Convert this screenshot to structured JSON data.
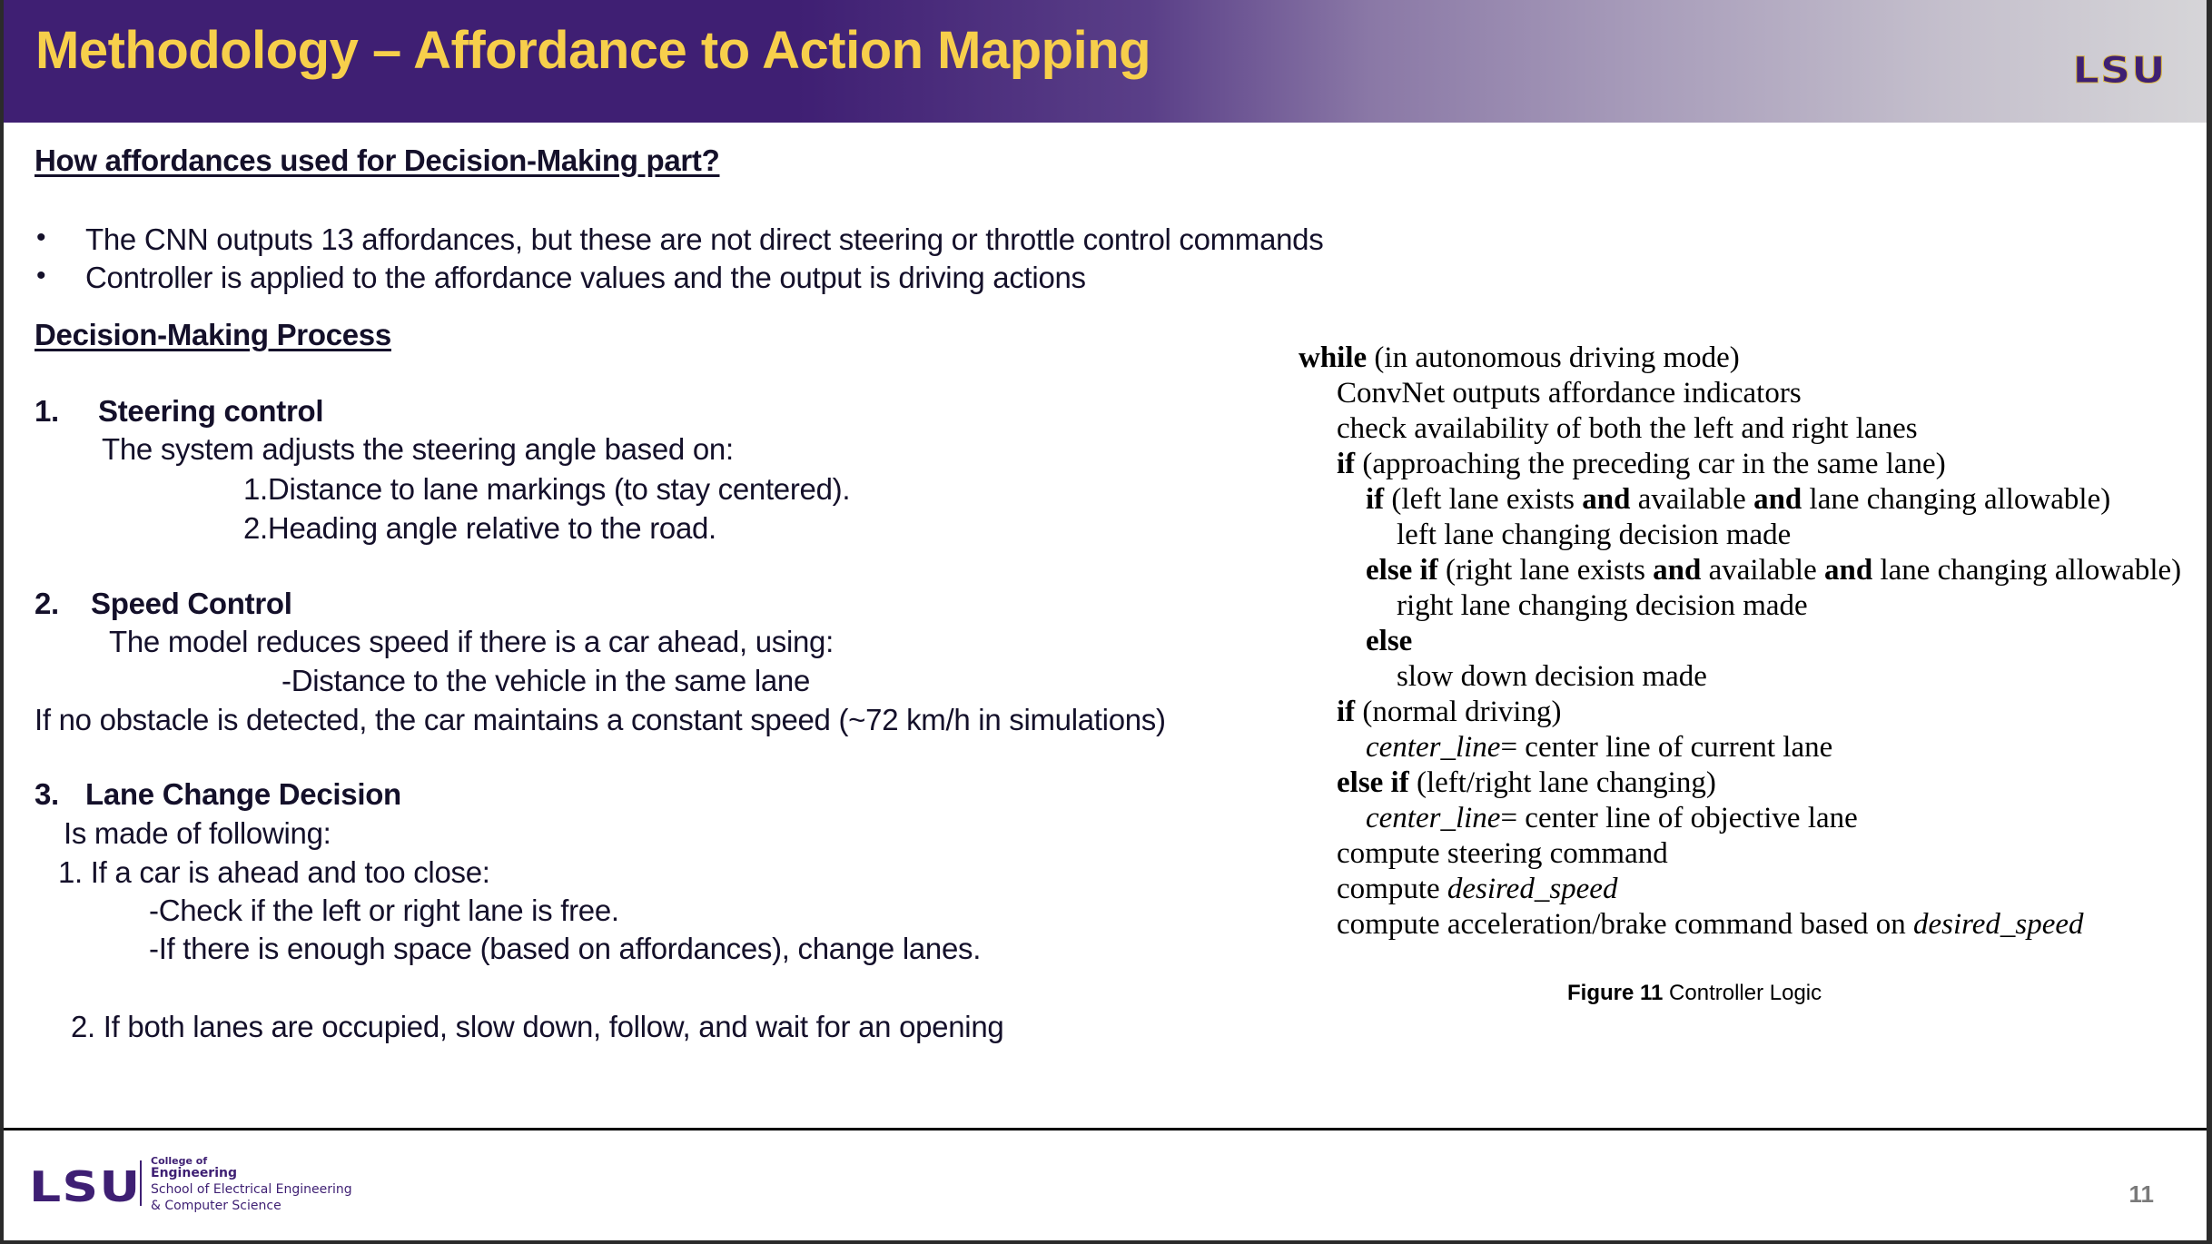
{
  "header": {
    "title": "Methodology – Affordance to Action Mapping",
    "logo_text": "LSU"
  },
  "intro": {
    "heading": "How affordances used for Decision-Making part?",
    "bullets": [
      "The CNN outputs 13 affordances, but these are not direct steering or throttle control commands",
      "Controller is applied to the affordance values and the output is driving actions"
    ]
  },
  "process": {
    "heading": "Decision-Making Process",
    "steering": {
      "number": "1.",
      "title": "Steering control",
      "intro": "The system adjusts the steering angle based on:",
      "items": [
        "1.Distance to lane markings (to stay centered).",
        "2.Heading angle relative to the road."
      ]
    },
    "speed": {
      "number": "2.",
      "title": "Speed Control",
      "intro": "The model reduces speed if there is a car ahead, using:",
      "items": [
        "-Distance to the vehicle in the same lane"
      ],
      "note": "If no obstacle is detected, the car maintains a constant speed (~72 km/h in simulations)"
    },
    "lane_change": {
      "number": "3.",
      "title": "Lane Change Decision",
      "intro": "Is made of following:",
      "case1": "1. If a car is ahead and too close:",
      "case1_items": [
        "-Check if the left or right lane is free.",
        "-If there is enough space (based on affordances), change lanes."
      ],
      "case2": "2. If both lanes are occupied, slow down, follow, and wait for an opening"
    }
  },
  "figure": {
    "lines": [
      {
        "kw": "while",
        "text": " (in autonomous driving mode)"
      },
      {
        "text": "ConvNet outputs affordance indicators"
      },
      {
        "text": "check availability of both the left and right lanes"
      },
      {
        "kw": "if",
        "text": " (approaching the preceding car in the same lane)"
      },
      {
        "kw": "if",
        "t1": " (left lane exists ",
        "and1": "and",
        "t2": " available ",
        "and2": "and",
        "t3": " lane changing allowable)"
      },
      {
        "text": "left lane changing decision made"
      },
      {
        "kw": "else if",
        "t1": " (right lane exists ",
        "and1": "and",
        "t2": " available ",
        "and2": "and",
        "t3": " lane changing allowable)"
      },
      {
        "text": "right lane changing decision made"
      },
      {
        "kw": "else"
      },
      {
        "text": "slow down decision made"
      },
      {
        "kw": "if",
        "text": " (normal driving)"
      },
      {
        "var": "center_line",
        "text": "= center line of current lane"
      },
      {
        "kw": "else if",
        "text": " (left/right lane changing)"
      },
      {
        "var": "center_line",
        "text": "= center line of objective lane"
      },
      {
        "text": "compute steering command"
      },
      {
        "text": "compute ",
        "var": "desired_speed"
      },
      {
        "text": "compute acceleration/brake command based on ",
        "var": "desired_speed"
      }
    ],
    "caption_label": "Figure 11",
    "caption_text": " Controller Logic"
  },
  "footer": {
    "logo_text": "LSU",
    "college_of": "College of",
    "engineering": "Engineering",
    "school_line1": "School of Electrical Engineering",
    "school_line2": "& Computer Science",
    "page_number": "11"
  },
  "colors": {
    "lsu_purple": "#3e1f73",
    "lsu_gold": "#f7cf4b"
  }
}
